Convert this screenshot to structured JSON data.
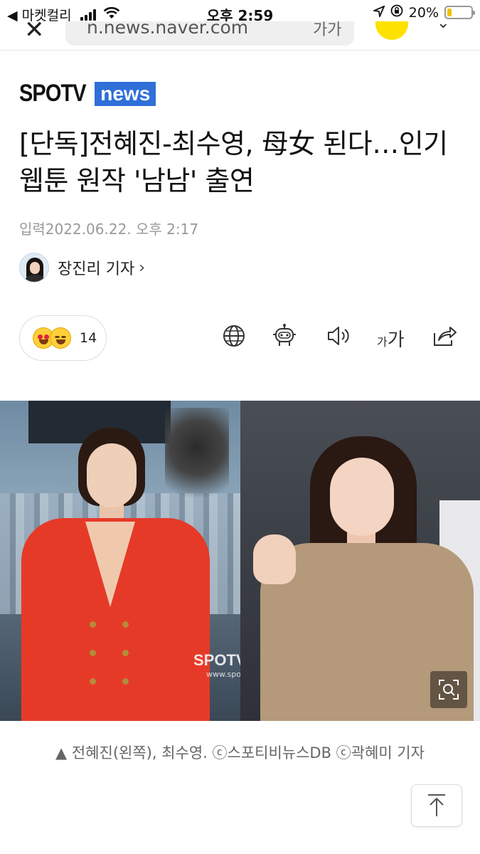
{
  "status_bar": {
    "back_label": "◀ 마켓컬리",
    "time": "오후 2:59",
    "battery_percent": "20%",
    "battery_level": 0.2
  },
  "browser": {
    "url": "n.news.naver.com",
    "go_label": "가가"
  },
  "publisher": {
    "logo_left": "SPOTV",
    "logo_right": "news"
  },
  "article": {
    "headline": "[단독]전혜진-최수영, 母女 된다…인기 웹툰 원작 '남남' 출연",
    "published": "입력2022.06.22. 오후 2:17",
    "reporter": "장진리 기자",
    "reporter_arrow": "›"
  },
  "toolbar": {
    "reaction_count": "14",
    "font_size_small": "가",
    "font_size_large": "가",
    "icons": [
      "globe-icon",
      "robot-summary-icon",
      "speaker-icon",
      "font-size-icon",
      "share-icon"
    ]
  },
  "photo": {
    "watermark": "SPOTVnews",
    "watermark_sub": "www.spotvnews.co.kr",
    "caption": "▲ 전혜진(왼쪽), 최수영. ⓒ스포티비뉴스DB ⓒ곽혜미 기자"
  },
  "colors": {
    "brand_blue": "#2f6fd8",
    "kakao_yellow": "#fde100"
  }
}
